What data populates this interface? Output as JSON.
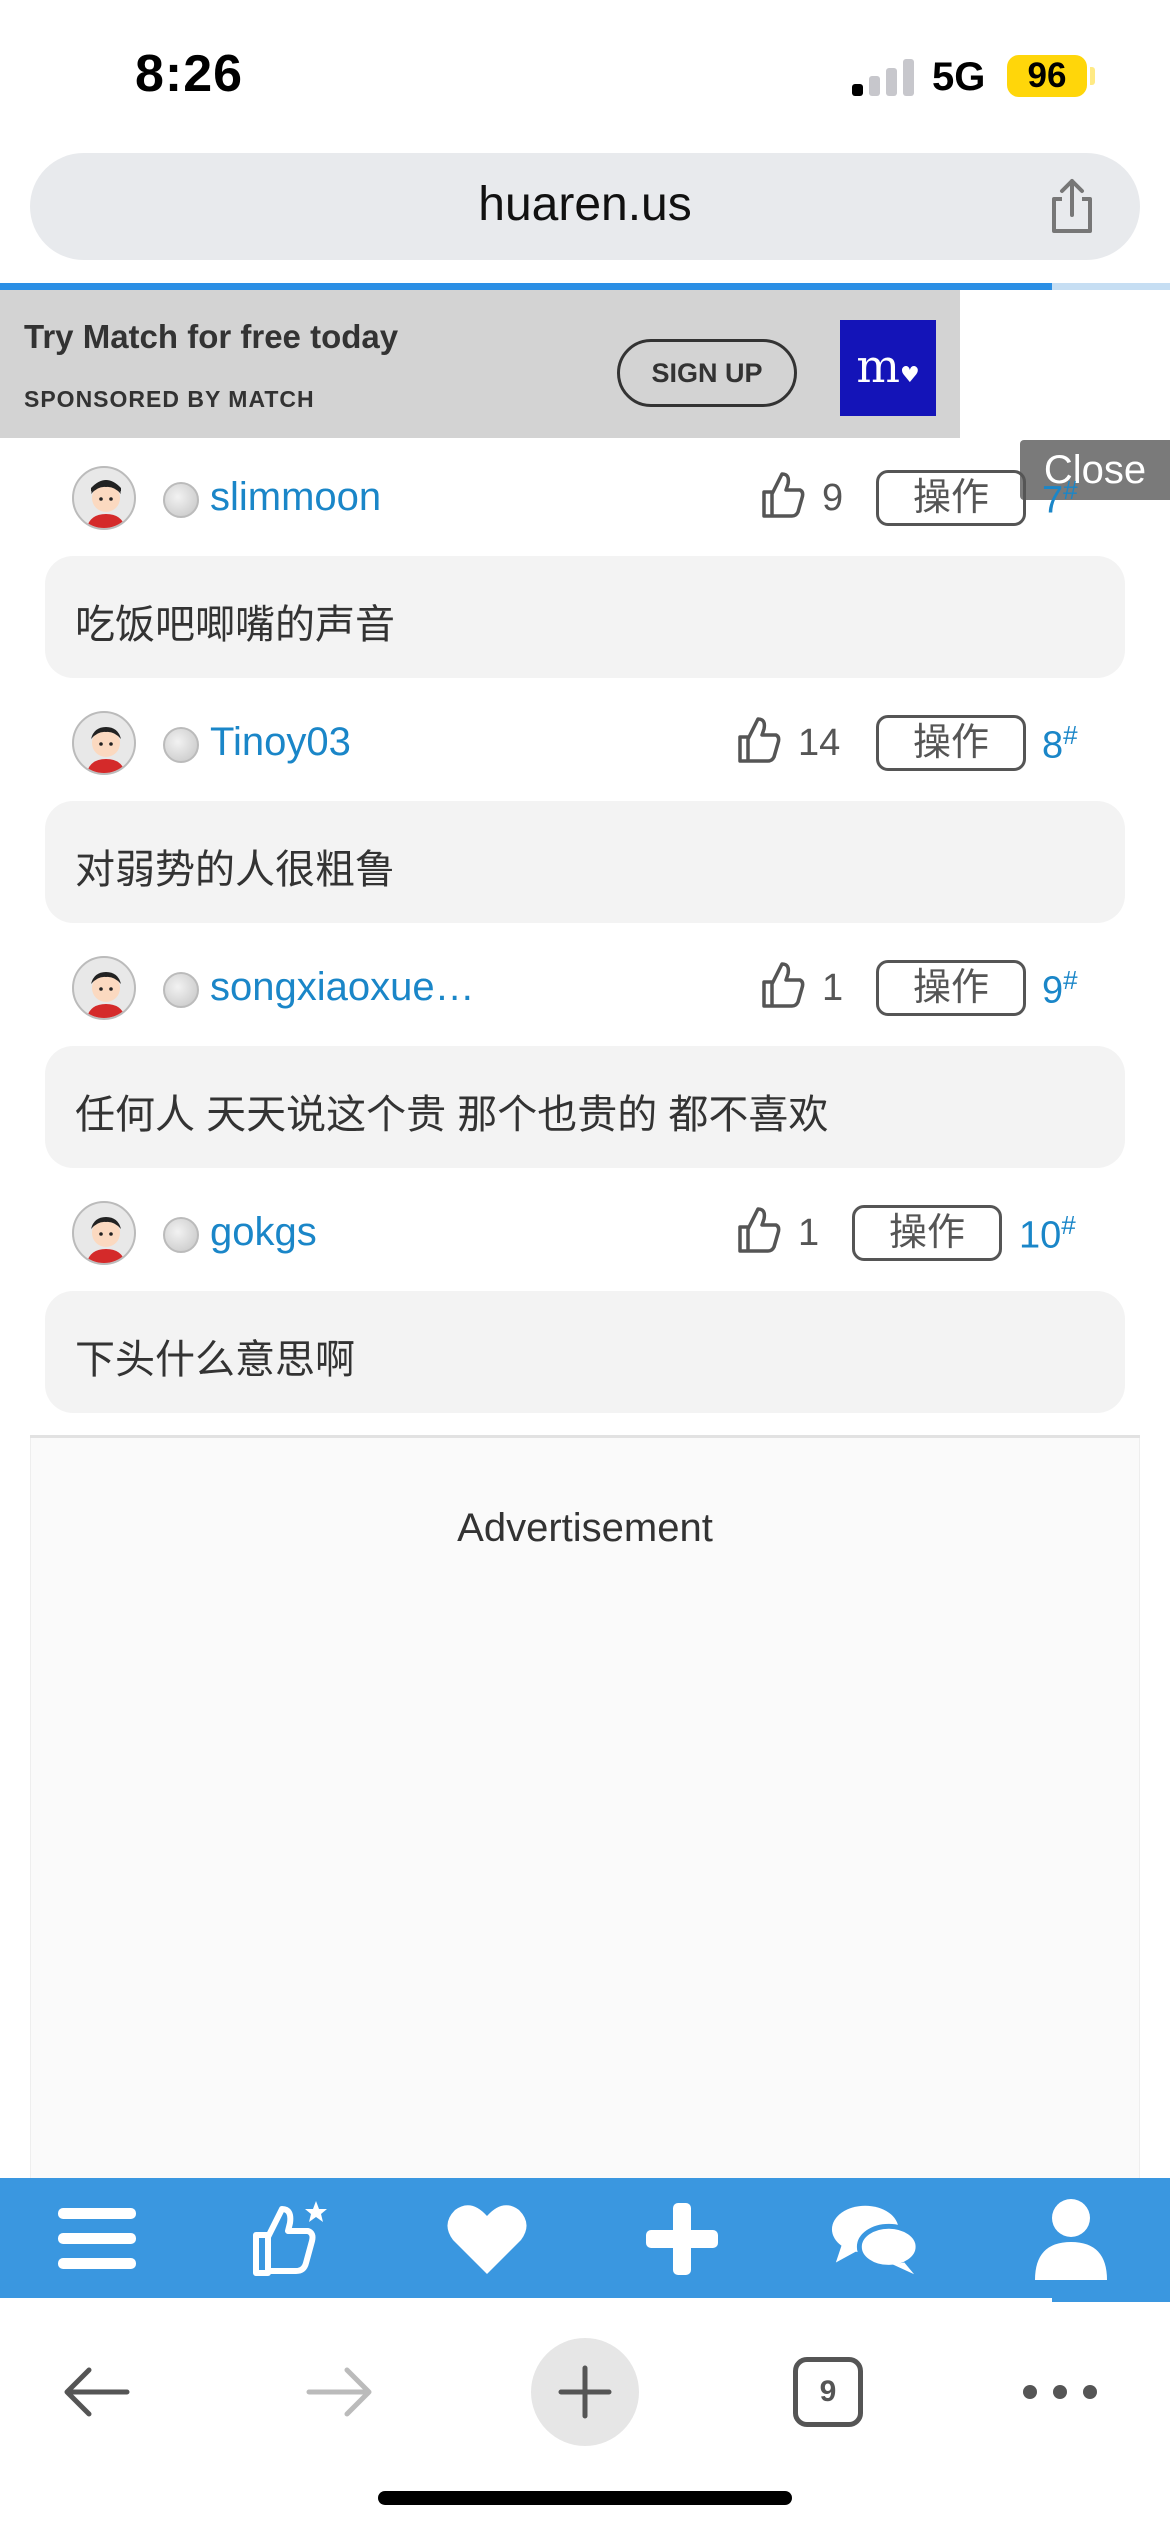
{
  "status_bar": {
    "time": "8:26",
    "network": "5G",
    "battery": "96"
  },
  "browser": {
    "url": "huaren.us",
    "tab_count": "9"
  },
  "ad_banner": {
    "title": "Try Match for free today",
    "sponsor": "SPONSORED BY MATCH",
    "signup_label": "SIGN UP",
    "logo_text": "m",
    "close_label": "Close",
    "brand_color": "#1414b8"
  },
  "posts": [
    {
      "username": "slimmoon",
      "likes": "9",
      "op_label": "操作",
      "floor": "7",
      "floor_mark": "#",
      "content": "吃饭吧唧嘴的声音"
    },
    {
      "username": "Tinoy03",
      "likes": "14",
      "op_label": "操作",
      "floor": "8",
      "floor_mark": "#",
      "content": "对弱势的人很粗鲁"
    },
    {
      "username": "songxiaoxue…",
      "likes": "1",
      "op_label": "操作",
      "floor": "9",
      "floor_mark": "#",
      "content": "任何人 天天说这个贵 那个也贵的 都不喜欢"
    },
    {
      "username": "gokgs",
      "likes": "1",
      "op_label": "操作",
      "floor": "10",
      "floor_mark": "#",
      "content": "下头什么意思啊"
    }
  ],
  "advertisement_label": "Advertisement",
  "bottom_nav": {
    "items": [
      "menu-icon",
      "thumbs-up-star-icon",
      "heart-icon",
      "plus-icon",
      "chat-icon",
      "user-icon"
    ],
    "color": "#3a97e0"
  },
  "colors": {
    "link": "#1a86c8",
    "accent": "#2b8fe5"
  }
}
